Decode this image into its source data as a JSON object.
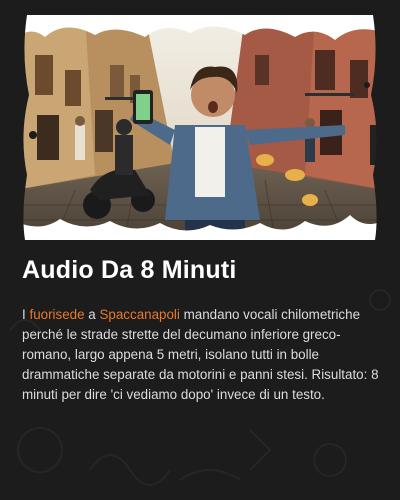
{
  "article": {
    "title": "Audio Da 8 Minuti",
    "body": {
      "lead": "I",
      "highlight_1": "fuorisede",
      "connector": "a",
      "highlight_2": "Spaccanapoli",
      "rest": "mandano vocali chilometriche perché le strade strette del decumano inferiore greco-romano, largo appena 5 metri, isolano tutti in bolle drammatiche separate da motorini e panni stesi. Risultato: 8 minuti per dire 'ci vediamo dopo' invece di un testo."
    }
  },
  "hero_image": {
    "subject": "street-scene-illustration",
    "accent_color": "#e8782a"
  },
  "colors": {
    "background": "#1c1c1c",
    "title": "#ffffff",
    "text": "#dcdcdc",
    "highlight": "#e8782a"
  }
}
